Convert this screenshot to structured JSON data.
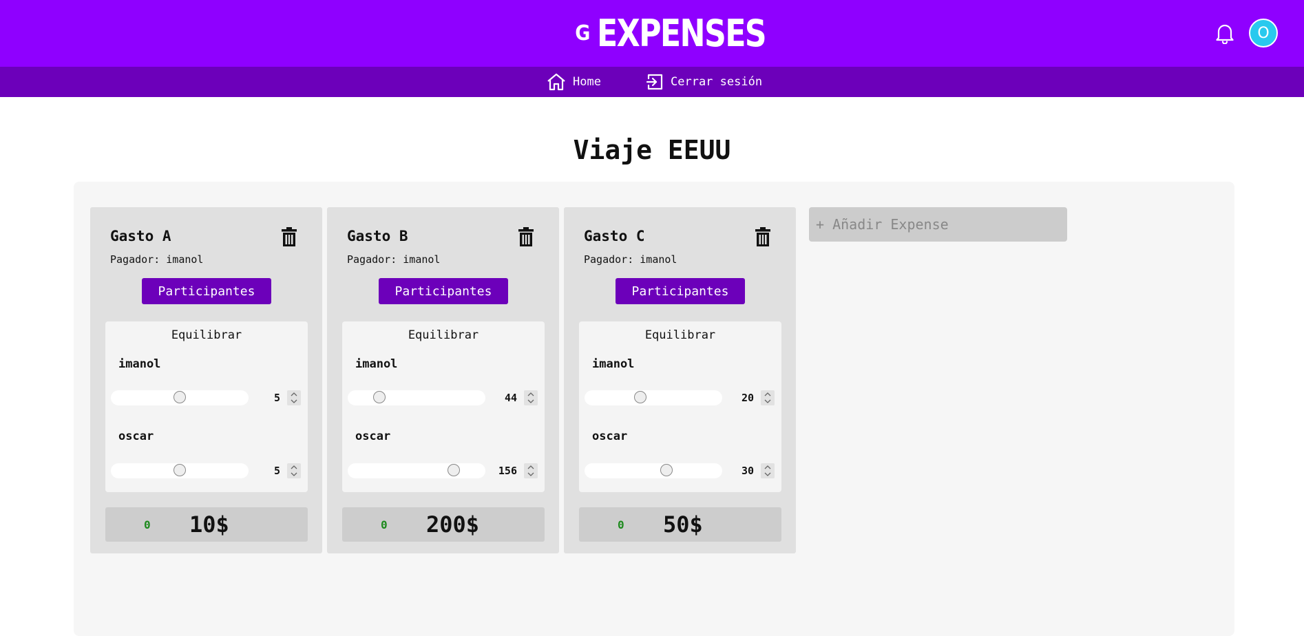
{
  "header": {
    "logo_mark": "G",
    "logo_text": "EXPENSES",
    "notifications_icon": "bell-icon",
    "avatar_text": "O",
    "colors": {
      "header_bg": "#8f00ff",
      "nav_bg": "#6c00ba",
      "avatar_bg": "#29c9ee"
    }
  },
  "nav": {
    "items": [
      {
        "label": "Home",
        "icon": "home-icon"
      },
      {
        "label": "Cerrar sesión",
        "icon": "logout-icon"
      }
    ]
  },
  "page": {
    "title": "Viaje EEUU"
  },
  "expenses": [
    {
      "title": "Gasto A",
      "payer": "Pagador: imanol",
      "participants_label": "Participantes",
      "balance_title": "Equilibrar",
      "people": [
        {
          "name": "imanol",
          "value": "5",
          "slider_fraction": 0.5
        },
        {
          "name": "oscar",
          "value": "5",
          "slider_fraction": 0.5
        }
      ],
      "status": "0",
      "total": "10$"
    },
    {
      "title": "Gasto B",
      "payer": "Pagador: imanol",
      "participants_label": "Participantes",
      "balance_title": "Equilibrar",
      "people": [
        {
          "name": "imanol",
          "value": "44",
          "slider_fraction": 0.22
        },
        {
          "name": "oscar",
          "value": "156",
          "slider_fraction": 0.78
        }
      ],
      "status": "0",
      "total": "200$"
    },
    {
      "title": "Gasto C",
      "payer": "Pagador: imanol",
      "participants_label": "Participantes",
      "balance_title": "Equilibrar",
      "people": [
        {
          "name": "imanol",
          "value": "20",
          "slider_fraction": 0.4
        },
        {
          "name": "oscar",
          "value": "30",
          "slider_fraction": 0.6
        }
      ],
      "status": "0",
      "total": "50$"
    }
  ],
  "add_expense": {
    "label": "+ Añadir Expense"
  }
}
